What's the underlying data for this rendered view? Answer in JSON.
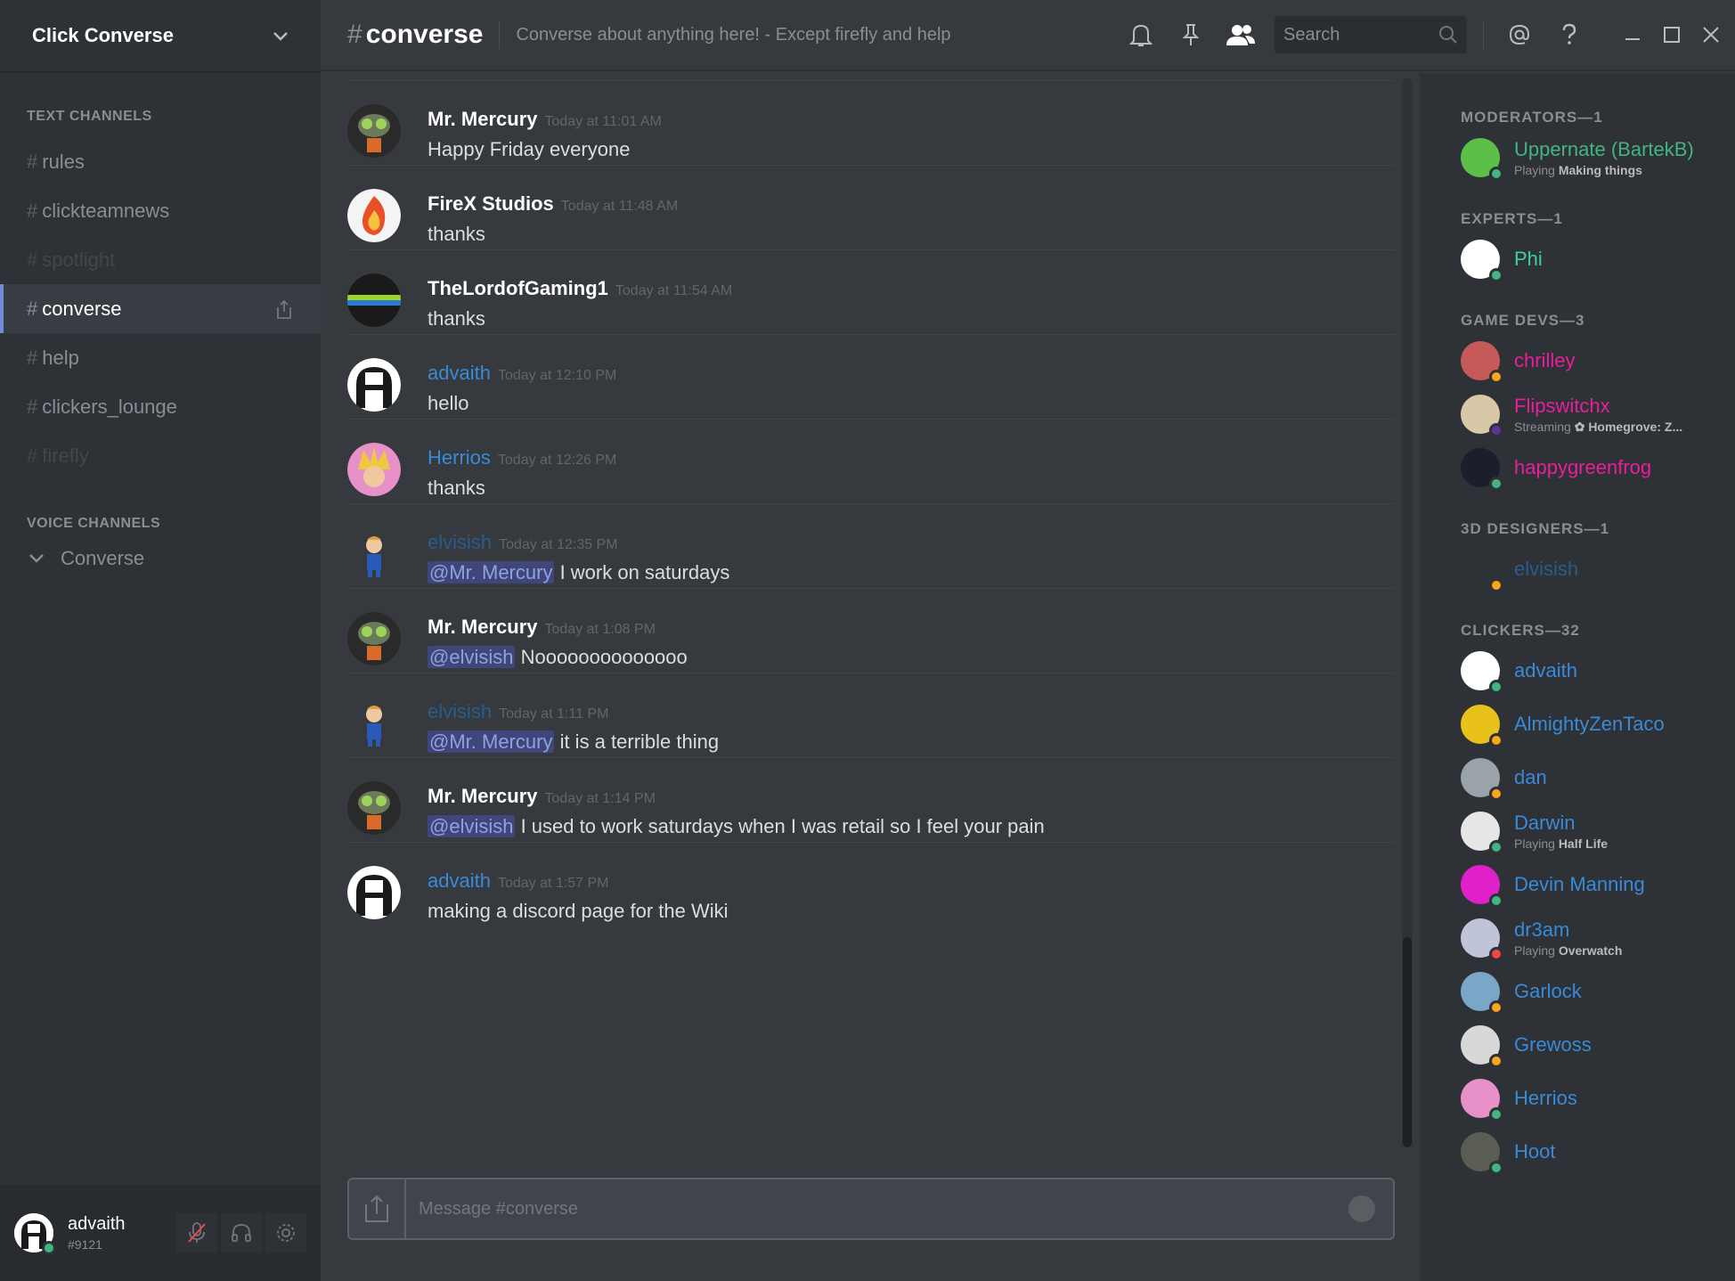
{
  "server": {
    "name": "Click Converse"
  },
  "sidebar": {
    "text_category": "TEXT CHANNELS",
    "channels": [
      {
        "hash": "#",
        "name": "rules",
        "state": "normal"
      },
      {
        "hash": "#",
        "name": "clickteamnews",
        "state": "normal"
      },
      {
        "hash": "#",
        "name": "spotlight",
        "state": "muted"
      },
      {
        "hash": "#",
        "name": "converse",
        "state": "active"
      },
      {
        "hash": "#",
        "name": "help",
        "state": "normal"
      },
      {
        "hash": "#",
        "name": "clickers_lounge",
        "state": "normal"
      },
      {
        "hash": "#",
        "name": "firefly",
        "state": "muted"
      }
    ],
    "voice_category": "VOICE CHANNELS",
    "voice_channels": [
      {
        "name": "Converse"
      }
    ]
  },
  "user_panel": {
    "name": "advaith",
    "tag": "#9121"
  },
  "topbar": {
    "hash": "#",
    "channel": "converse",
    "topic": "Converse about anything here! - Except firefly and help",
    "search_placeholder": "Search"
  },
  "messages": [
    {
      "author": "Mr. Mercury",
      "time": "Today at 11:01 AM",
      "mention": "",
      "text": "Happy Friday everyone",
      "style": "white",
      "avatar": "mercury"
    },
    {
      "author": "FireX Studios",
      "time": "Today at 11:48 AM",
      "mention": "",
      "text": "thanks",
      "style": "white",
      "avatar": "firex"
    },
    {
      "author": "TheLordofGaming1",
      "time": "Today at 11:54 AM",
      "mention": "",
      "text": "thanks",
      "style": "white",
      "avatar": "lord"
    },
    {
      "author": "advaith",
      "time": "Today at 12:10 PM",
      "mention": "",
      "text": "hello",
      "style": "blue",
      "avatar": "advaith"
    },
    {
      "author": "Herrios",
      "time": "Today at 12:26 PM",
      "mention": "",
      "text": "thanks",
      "style": "blue",
      "avatar": "herrios"
    },
    {
      "author": "elvisish",
      "time": "Today at 12:35 PM",
      "mention": "@Mr. Mercury",
      "text": " I work on saturdays",
      "style": "faint",
      "avatar": "elvisish"
    },
    {
      "author": "Mr. Mercury",
      "time": "Today at 1:08 PM",
      "mention": "@elvisish",
      "text": " Noooooooooooooo",
      "style": "white",
      "avatar": "mercury"
    },
    {
      "author": "elvisish",
      "time": "Today at 1:11 PM",
      "mention": "@Mr. Mercury",
      "text": " it is a terrible thing",
      "style": "faint",
      "avatar": "elvisish"
    },
    {
      "author": "Mr. Mercury",
      "time": "Today at 1:14 PM",
      "mention": "@elvisish",
      "text": " I used to work saturdays when I was retail so I feel your pain",
      "style": "white",
      "avatar": "mercury"
    },
    {
      "author": "advaith",
      "time": "Today at 1:57 PM",
      "mention": "",
      "text": "making a discord page for the Wiki",
      "style": "blue",
      "avatar": "advaith"
    }
  ],
  "composer": {
    "placeholder": "Message #converse"
  },
  "members": {
    "groups": [
      {
        "label": "MODERATORS—1",
        "members": [
          {
            "name": "Uppernate (BartekB)",
            "activity_prefix": "Playing",
            "activity": "Making things",
            "color": "green",
            "status": "online",
            "avatar_color": "#5bbf4a"
          }
        ]
      },
      {
        "label": "EXPERTS—1",
        "members": [
          {
            "name": "Phi",
            "activity_prefix": "",
            "activity": "",
            "color": "teal",
            "status": "online",
            "avatar_color": "#ffffff"
          }
        ]
      },
      {
        "label": "GAME DEVS—3",
        "members": [
          {
            "name": "chrilley",
            "activity_prefix": "",
            "activity": "",
            "color": "pink",
            "status": "idle",
            "avatar_color": "#c65a5a"
          },
          {
            "name": "Flipswitchx",
            "activity_prefix": "Streaming",
            "activity": "✿ Homegrove: Z...",
            "color": "pink",
            "status": "streaming",
            "avatar_color": "#d8c8a8"
          },
          {
            "name": "happygreenfrog",
            "activity_prefix": "",
            "activity": "",
            "color": "pink",
            "status": "online",
            "avatar_color": "#1b1f2b"
          }
        ]
      },
      {
        "label": "3D DESIGNERS—1",
        "members": [
          {
            "name": "elvisish",
            "activity_prefix": "",
            "activity": "",
            "color": "faintblue",
            "status": "idle",
            "avatar_color": "#2e3136"
          }
        ]
      },
      {
        "label": "CLICKERS—32",
        "members": [
          {
            "name": "advaith",
            "activity_prefix": "",
            "activity": "",
            "color": "blue",
            "status": "online",
            "avatar_color": "#ffffff"
          },
          {
            "name": "AlmightyZenTaco",
            "activity_prefix": "",
            "activity": "",
            "color": "blue",
            "status": "idle",
            "avatar_color": "#e8c21a"
          },
          {
            "name": "dan",
            "activity_prefix": "",
            "activity": "",
            "color": "blue",
            "status": "idle",
            "avatar_color": "#9aa3a8"
          },
          {
            "name": "Darwin",
            "activity_prefix": "Playing",
            "activity": "Half Life",
            "color": "blue",
            "status": "online",
            "avatar_color": "#e6e6e6"
          },
          {
            "name": "Devin Manning",
            "activity_prefix": "",
            "activity": "",
            "color": "blue",
            "status": "online",
            "avatar_color": "#e020c8"
          },
          {
            "name": "dr3am",
            "activity_prefix": "Playing",
            "activity": "Overwatch",
            "color": "blue",
            "status": "dnd",
            "avatar_color": "#c0c4d8"
          },
          {
            "name": "Garlock",
            "activity_prefix": "",
            "activity": "",
            "color": "blue",
            "status": "idle",
            "avatar_color": "#7aa6c8"
          },
          {
            "name": "Grewoss",
            "activity_prefix": "",
            "activity": "",
            "color": "blue",
            "status": "idle",
            "avatar_color": "#d8d8d8"
          },
          {
            "name": "Herrios",
            "activity_prefix": "",
            "activity": "",
            "color": "blue",
            "status": "online",
            "avatar_color": "#e890c8"
          },
          {
            "name": "Hoot",
            "activity_prefix": "",
            "activity": "",
            "color": "blue",
            "status": "online",
            "avatar_color": "#5a5e52"
          }
        ]
      }
    ]
  },
  "colors": {
    "online": "#43b581",
    "idle": "#faa61a",
    "dnd": "#f04747",
    "streaming": "#593695",
    "accent": "#7289da"
  }
}
